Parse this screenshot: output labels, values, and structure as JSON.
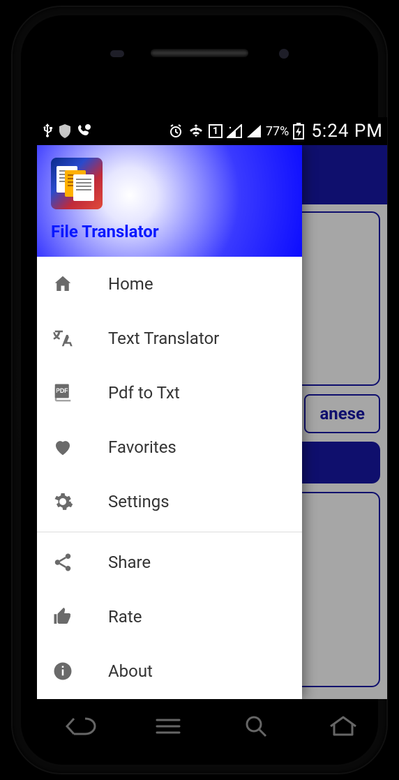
{
  "status": {
    "battery_pct": "77%",
    "clock": "5:24 PM",
    "sim_badge": "1"
  },
  "app_behind": {
    "language_label": "anese"
  },
  "drawer": {
    "title": "File Translator",
    "items": [
      {
        "icon": "home",
        "label": "Home"
      },
      {
        "icon": "translate",
        "label": "Text Translator"
      },
      {
        "icon": "pdf",
        "label": "Pdf to Txt"
      },
      {
        "icon": "heart",
        "label": "Favorites"
      },
      {
        "icon": "gear",
        "label": "Settings"
      }
    ],
    "items2": [
      {
        "icon": "share",
        "label": "Share"
      },
      {
        "icon": "thumb",
        "label": "Rate"
      },
      {
        "icon": "info",
        "label": "About"
      }
    ]
  }
}
